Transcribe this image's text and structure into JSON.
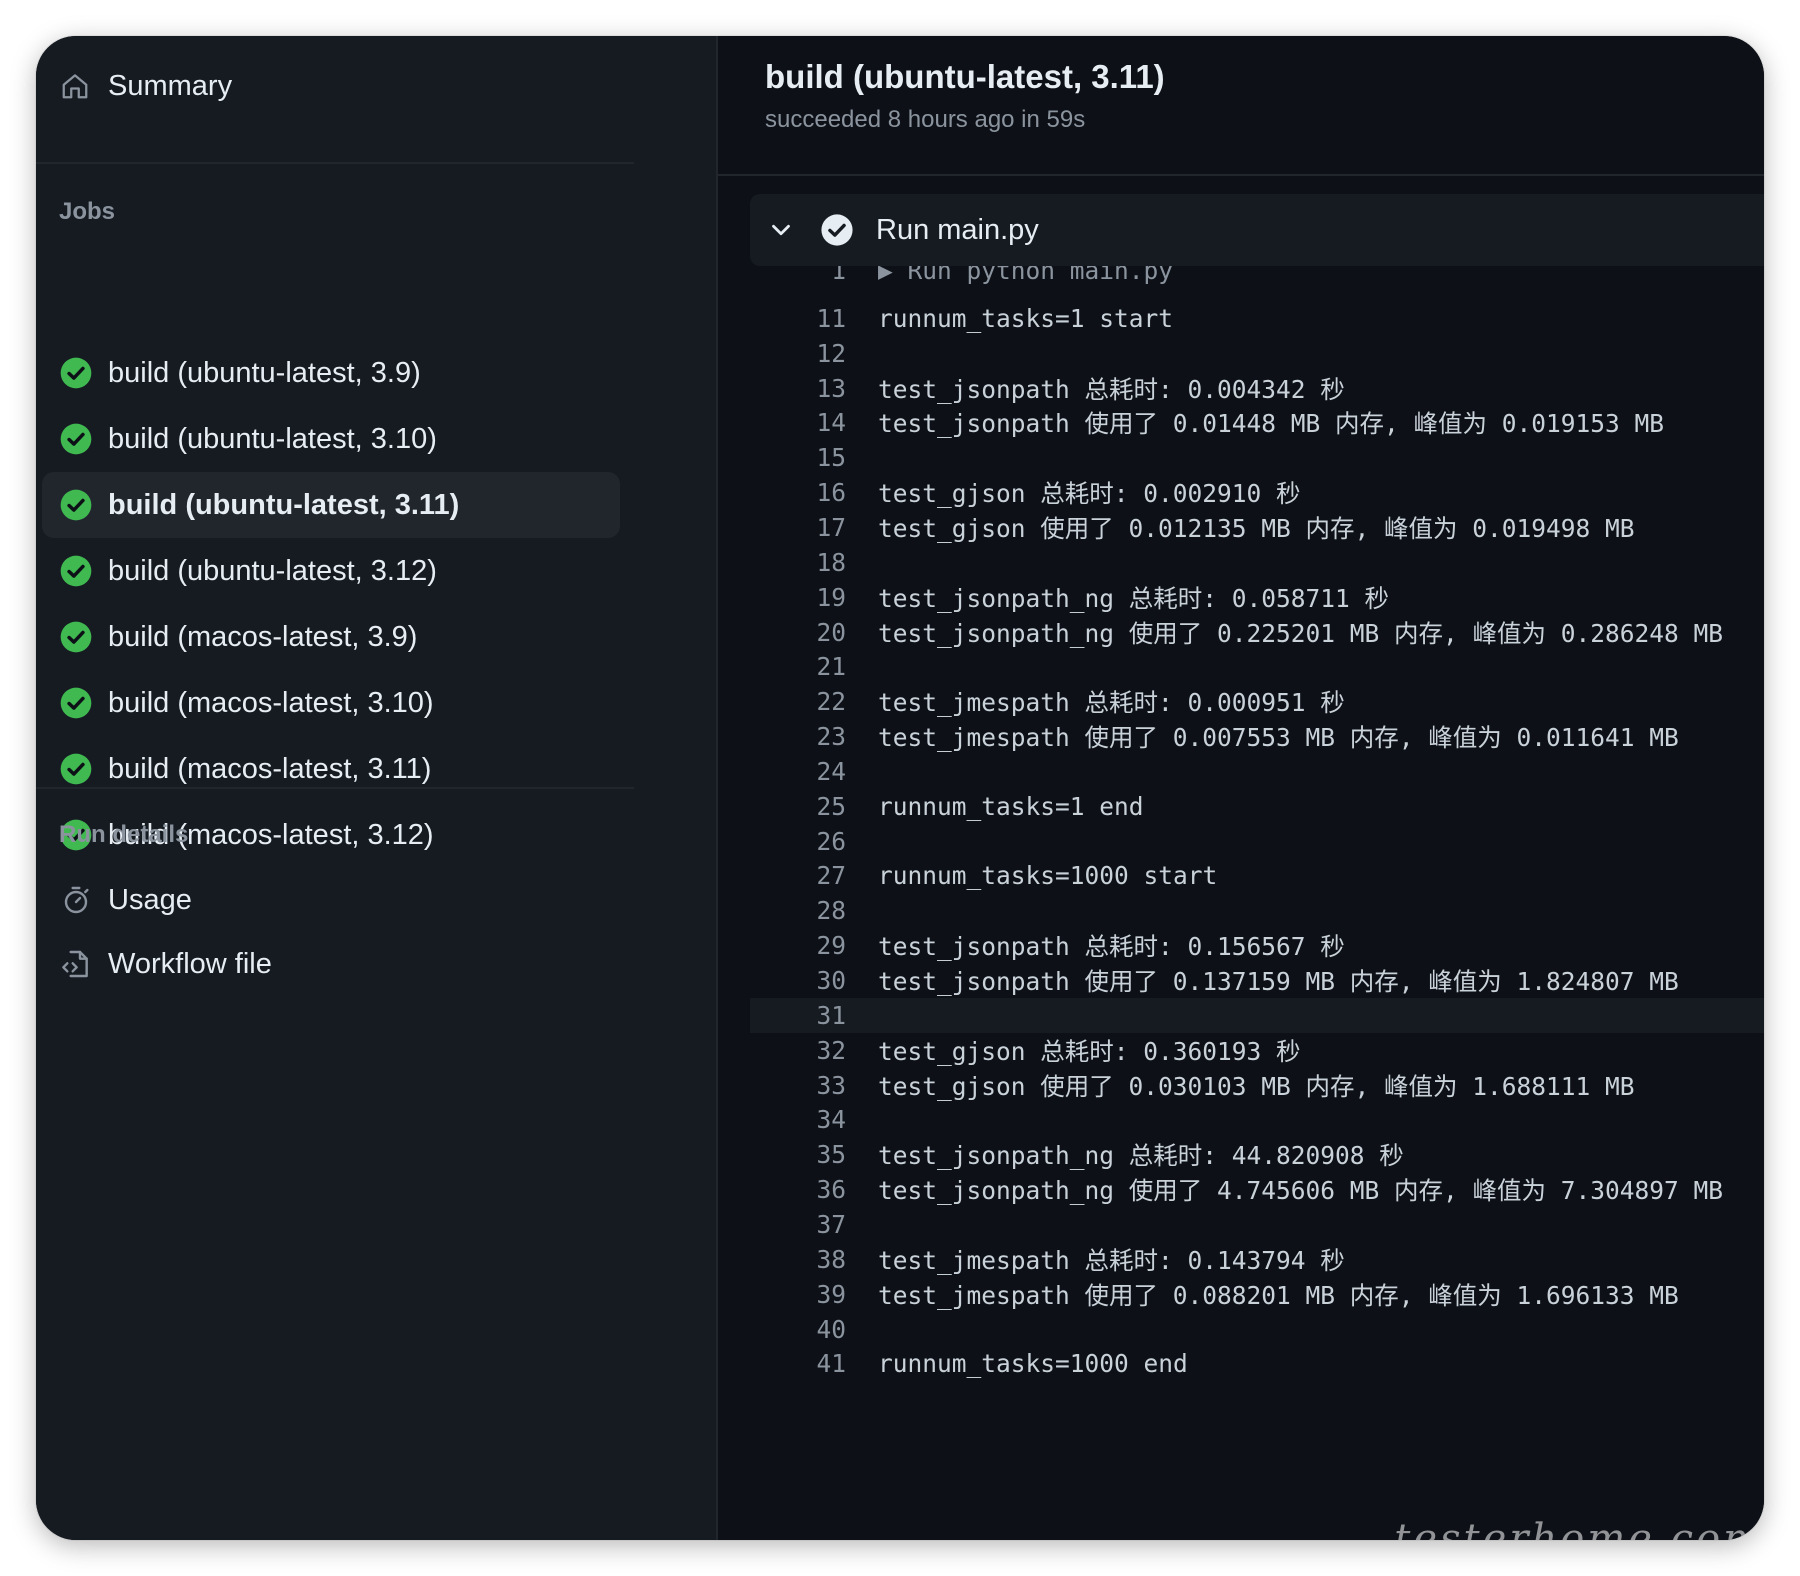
{
  "sidebar": {
    "summary_label": "Summary",
    "jobs_title": "Jobs",
    "jobs": [
      {
        "label": "build (ubuntu-latest, 3.9)",
        "status": "success"
      },
      {
        "label": "build (ubuntu-latest, 3.10)",
        "status": "success"
      },
      {
        "label": "build (ubuntu-latest, 3.11)",
        "status": "success",
        "active": true
      },
      {
        "label": "build (ubuntu-latest, 3.12)",
        "status": "success"
      },
      {
        "label": "build (macos-latest, 3.9)",
        "status": "success"
      },
      {
        "label": "build (macos-latest, 3.10)",
        "status": "success"
      },
      {
        "label": "build (macos-latest, 3.11)",
        "status": "success"
      },
      {
        "label": "build (macos-latest, 3.12)",
        "status": "success"
      }
    ],
    "run_details_title": "Run details",
    "usage_label": "Usage",
    "workflow_file_label": "Workflow file"
  },
  "main": {
    "job_title": "build (ubuntu-latest, 3.11)",
    "job_status": "succeeded 8 hours ago in 59s",
    "step_title": "Run main.py",
    "log": [
      {
        "n": "1",
        "t": "▶ Run python main.py",
        "run": true
      },
      {
        "n": "11",
        "t": "runnum_tasks=1 start"
      },
      {
        "n": "12",
        "t": ""
      },
      {
        "n": "13",
        "t": "test_jsonpath 总耗时: 0.004342 秒"
      },
      {
        "n": "14",
        "t": "test_jsonpath 使用了 0.01448 MB 内存, 峰值为 0.019153 MB"
      },
      {
        "n": "15",
        "t": ""
      },
      {
        "n": "16",
        "t": "test_gjson 总耗时: 0.002910 秒"
      },
      {
        "n": "17",
        "t": "test_gjson 使用了 0.012135 MB 内存, 峰值为 0.019498 MB"
      },
      {
        "n": "18",
        "t": ""
      },
      {
        "n": "19",
        "t": "test_jsonpath_ng 总耗时: 0.058711 秒"
      },
      {
        "n": "20",
        "t": "test_jsonpath_ng 使用了 0.225201 MB 内存, 峰值为 0.286248 MB"
      },
      {
        "n": "21",
        "t": ""
      },
      {
        "n": "22",
        "t": "test_jmespath 总耗时: 0.000951 秒"
      },
      {
        "n": "23",
        "t": "test_jmespath 使用了 0.007553 MB 内存, 峰值为 0.011641 MB"
      },
      {
        "n": "24",
        "t": ""
      },
      {
        "n": "25",
        "t": "runnum_tasks=1 end"
      },
      {
        "n": "26",
        "t": ""
      },
      {
        "n": "27",
        "t": "runnum_tasks=1000 start"
      },
      {
        "n": "28",
        "t": ""
      },
      {
        "n": "29",
        "t": "test_jsonpath 总耗时: 0.156567 秒"
      },
      {
        "n": "30",
        "t": "test_jsonpath 使用了 0.137159 MB 内存, 峰值为 1.824807 MB"
      },
      {
        "n": "31",
        "t": "",
        "highlight": true
      },
      {
        "n": "32",
        "t": "test_gjson 总耗时: 0.360193 秒"
      },
      {
        "n": "33",
        "t": "test_gjson 使用了 0.030103 MB 内存, 峰值为 1.688111 MB"
      },
      {
        "n": "34",
        "t": ""
      },
      {
        "n": "35",
        "t": "test_jsonpath_ng 总耗时: 44.820908 秒"
      },
      {
        "n": "36",
        "t": "test_jsonpath_ng 使用了 4.745606 MB 内存, 峰值为 7.304897 MB"
      },
      {
        "n": "37",
        "t": ""
      },
      {
        "n": "38",
        "t": "test_jmespath 总耗时: 0.143794 秒"
      },
      {
        "n": "39",
        "t": "test_jmespath 使用了 0.088201 MB 内存, 峰值为 1.696133 MB"
      },
      {
        "n": "40",
        "t": ""
      },
      {
        "n": "41",
        "t": "runnum_tasks=1000 end"
      }
    ]
  },
  "watermark": "testerhome.com",
  "colors": {
    "success": "#3fb950",
    "background": "#0d1117",
    "sidebar": "#161b22",
    "text": "#e6edf3",
    "muted": "#8b949e"
  }
}
